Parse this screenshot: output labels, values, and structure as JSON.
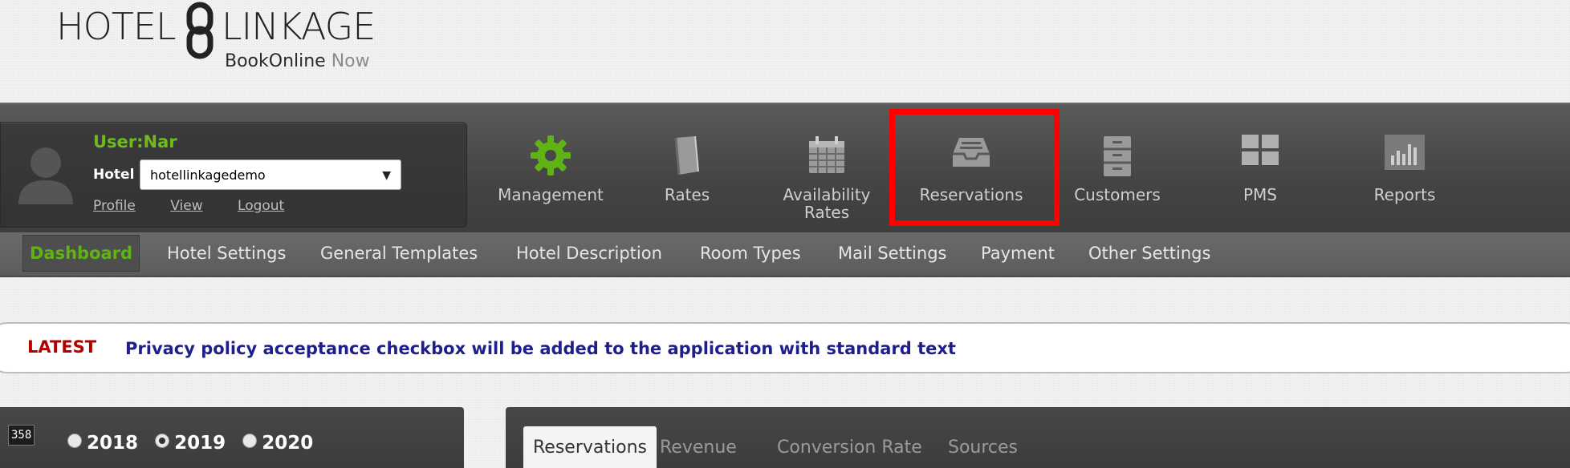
{
  "logo": {
    "word1": "HOTEL",
    "word2": "LINKAGE",
    "tagline_main": "BookOnline",
    "tagline_now": "Now"
  },
  "user": {
    "username": "User:Nar",
    "hotel_label": "Hotel",
    "hotel_selected": "hotellinkagedemo",
    "links": {
      "profile": "Profile",
      "view": "View",
      "logout": "Logout"
    }
  },
  "nav": {
    "management": "Management",
    "rates": "Rates",
    "availability_line1": "Availability",
    "availability_line2": "Rates",
    "reservations": "Reservations",
    "customers": "Customers",
    "pms": "PMS",
    "reports": "Reports"
  },
  "subnav": {
    "dashboard": "Dashboard",
    "hotel_settings": "Hotel Settings",
    "general_templates": "General Templates",
    "hotel_description": "Hotel Description",
    "room_types": "Room Types",
    "mail_settings": "Mail Settings",
    "payment": "Payment",
    "other_settings": "Other Settings"
  },
  "ticker": {
    "label": "LATEST",
    "message": "Privacy policy acceptance checkbox will be added to the application with standard text"
  },
  "years_panel": {
    "counter": "358",
    "years": [
      "2018",
      "2019",
      "2020"
    ],
    "selected_year": "2019"
  },
  "stats_tabs": {
    "reservations": "Reservations",
    "revenue": "Revenue",
    "conversion_rate": "Conversion Rate",
    "sources": "Sources"
  },
  "colors": {
    "accent_green": "#6fba1c",
    "highlight_red": "#ff0000",
    "ticker_label": "#b00000",
    "ticker_text": "#1f1f8c"
  }
}
